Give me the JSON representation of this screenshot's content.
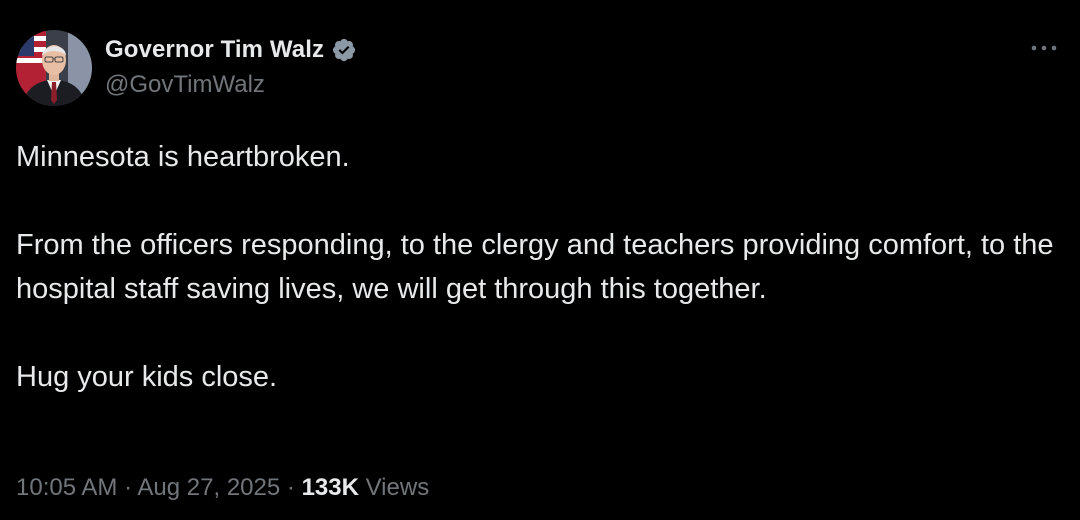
{
  "author": {
    "display_name": "Governor Tim Walz",
    "handle": "@GovTimWalz",
    "verified_icon": "verified-badge-icon",
    "verified_color": "#8b98a5"
  },
  "menu": {
    "icon": "more-horizontal-icon"
  },
  "tweet": {
    "paragraphs": [
      "Minnesota is heartbroken.",
      "From the officers responding, to the clergy and teachers providing comfort, to the hospital staff saving lives, we will get through this together.",
      "Hug your kids close."
    ]
  },
  "meta": {
    "time": "10:05 AM",
    "separator": "·",
    "date": "Aug 27, 2025",
    "views_count": "133K",
    "views_label": "Views"
  },
  "colors": {
    "background": "#000000",
    "text_primary": "#e7e9ea",
    "text_secondary": "#71767b"
  }
}
